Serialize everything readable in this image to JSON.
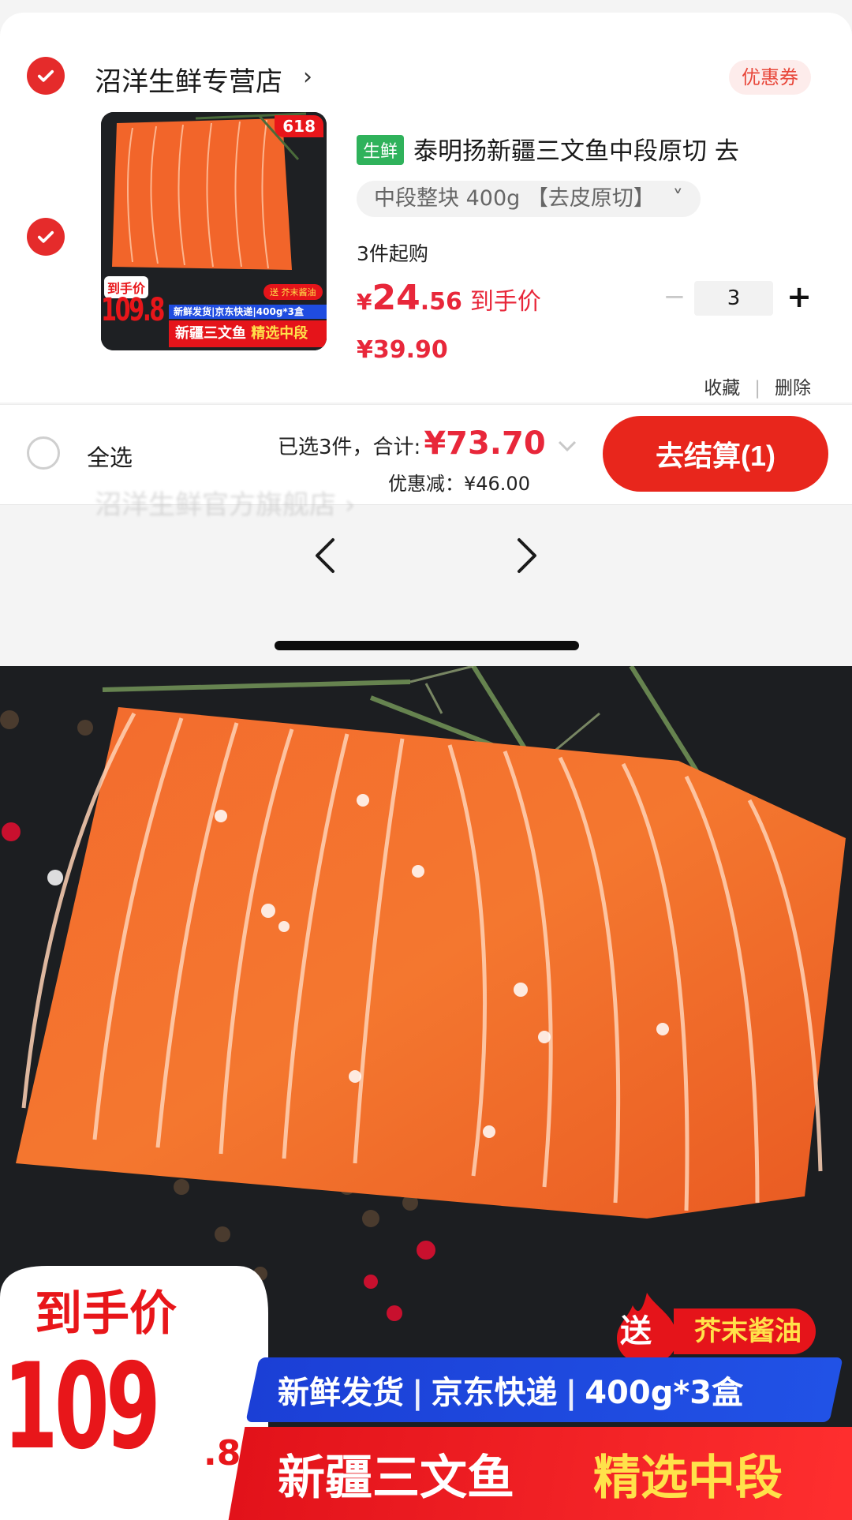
{
  "store": {
    "name": "沼洋生鲜专营店",
    "chevron": "›",
    "coupon_label": "优惠券"
  },
  "product": {
    "tag": "生鲜",
    "title": "泰明扬新疆三文鱼中段原切 去",
    "spec": "中段整块 400g 【去皮原切】",
    "spec_chevron": "˅",
    "min_buy": "3件起购",
    "price_yen": "¥",
    "price_int": "24",
    "price_dec": ".56",
    "price_label": "到手价",
    "original_price": "¥39.90",
    "quantity": "3",
    "minus": "−",
    "plus": "+",
    "favorite_label": "收藏",
    "delete_label": "删除",
    "thumb": {
      "badge_618": "618",
      "price_label": "到手价",
      "price_value": "109.8",
      "blue_line": "新鲜发货|京东快递|400g*3盒",
      "red_line_a": "新疆三文鱼",
      "red_line_b": "精选中段",
      "gift": "送 芥末酱油"
    }
  },
  "bottom_bar": {
    "select_all_label": "全选",
    "selected_text": "已选3件，合计:",
    "total": "¥73.70",
    "discount_text": "优惠减：¥46.00",
    "checkout_label": "去结算(1)"
  },
  "ghost_text": "沼洋生鲜官方旗舰店 ›",
  "hero": {
    "price_label": "到手价",
    "price_int": "109",
    "price_dec": ".8",
    "gift_send": "送",
    "gift_item": "芥末酱油",
    "blue_items": [
      "新鲜发货",
      "京东快递",
      "400g*3盒"
    ],
    "red_text_a": "新疆三文鱼",
    "red_text_b": "精选中段"
  },
  "colors": {
    "accent_red": "#e8261c",
    "price_red": "#e8273a",
    "fresh_green": "#2fb25b",
    "salmon": "#f2652a",
    "banner_blue": "#1b3fd6"
  },
  "icons": [
    "checkmark-icon",
    "chevron-right-icon",
    "chevron-down-icon",
    "arrow-left-icon",
    "arrow-right-icon",
    "fire-icon"
  ]
}
